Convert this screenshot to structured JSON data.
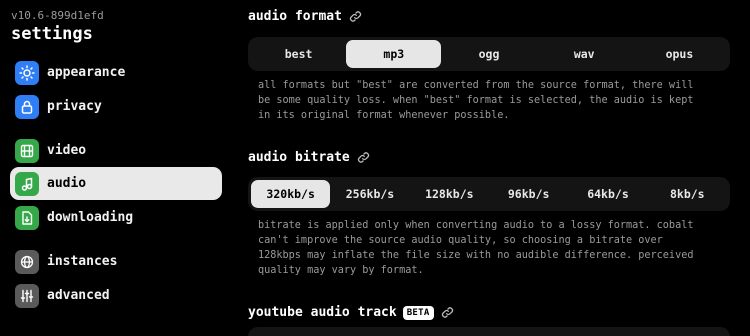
{
  "sidebar": {
    "version": "v10.6-899d1efd",
    "title": "settings",
    "items": [
      {
        "label": "appearance",
        "icon": "sun-icon",
        "color": "#2f7ef5"
      },
      {
        "label": "privacy",
        "icon": "lock-icon",
        "color": "#2f7ef5"
      },
      {
        "label": "video",
        "icon": "film-icon",
        "color": "#35a94a"
      },
      {
        "label": "audio",
        "icon": "music-note-icon",
        "color": "#35a94a",
        "active": true
      },
      {
        "label": "downloading",
        "icon": "file-download-icon",
        "color": "#35a94a"
      },
      {
        "label": "instances",
        "icon": "globe-icon",
        "color": "#5a5a5a"
      },
      {
        "label": "advanced",
        "icon": "sliders-icon",
        "color": "#5a5a5a"
      }
    ]
  },
  "audio_format": {
    "heading": "audio format",
    "options": [
      "best",
      "mp3",
      "ogg",
      "wav",
      "opus"
    ],
    "selected": "mp3",
    "description": "all formats but \"best\" are converted from the source format, there will\nbe some quality loss. when \"best\" format is selected, the audio is kept\nin its original format whenever possible."
  },
  "audio_bitrate": {
    "heading": "audio bitrate",
    "options": [
      "320kb/s",
      "256kb/s",
      "128kb/s",
      "96kb/s",
      "64kb/s",
      "8kb/s"
    ],
    "selected": "320kb/s",
    "description": "bitrate is applied only when converting audio to a lossy format. cobalt\ncan't improve the source audio quality, so choosing a bitrate over\n128kbps may inflate the file size with no audible difference. perceived\nquality may vary by format."
  },
  "youtube_audio_track": {
    "heading": "youtube audio track",
    "badge": "BETA"
  }
}
